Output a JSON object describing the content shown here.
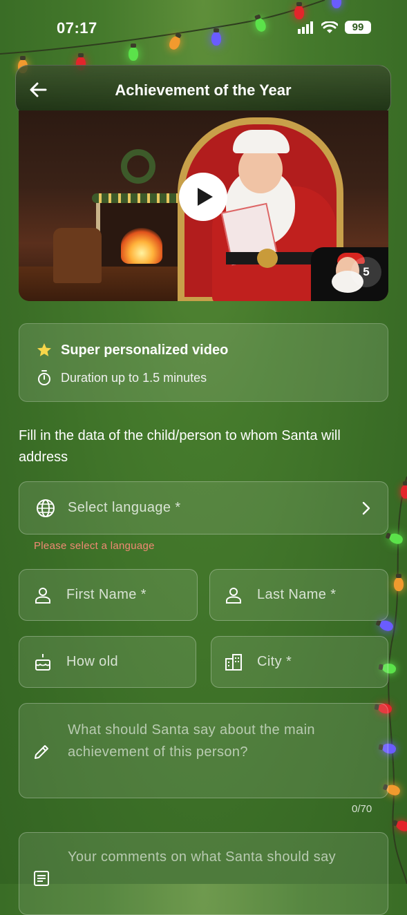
{
  "status_bar": {
    "time": "07:17",
    "battery": "99"
  },
  "header": {
    "title": "Achievement of the Year"
  },
  "video": {
    "badge": "5"
  },
  "info": {
    "title": "Super personalized video",
    "duration": "Duration up to 1.5 minutes"
  },
  "form": {
    "prompt": "Fill in the data of the child/person to whom Santa will address",
    "language": {
      "placeholder": "Select language *",
      "error": "Please select a language"
    },
    "first_name": {
      "placeholder": "First Name *"
    },
    "last_name": {
      "placeholder": "Last Name *"
    },
    "age": {
      "placeholder": "How old"
    },
    "city": {
      "placeholder": "City *"
    },
    "achievement": {
      "placeholder": "What should Santa say about the main achievement of this person?",
      "counter": "0/70"
    },
    "comments": {
      "placeholder": "Your comments on what Santa should say"
    }
  },
  "colors": {
    "background": "#3f732a",
    "error": "#f08a74"
  },
  "icons": [
    "back-arrow-icon",
    "play-icon",
    "star-icon",
    "stopwatch-icon",
    "globe-icon",
    "chevron-right-icon",
    "person-icon",
    "cake-icon",
    "city-icon",
    "pencil-icon",
    "notes-icon",
    "signal-icon",
    "wifi-icon",
    "battery-icon"
  ]
}
